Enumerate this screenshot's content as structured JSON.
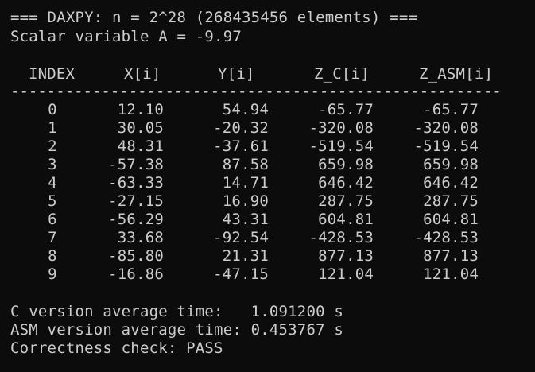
{
  "terminal": {
    "header_line": "=== DAXPY: n = 2^28 (268435456 elements) ===",
    "scalar_line": "Scalar variable A = -9.97",
    "columns": [
      "INDEX",
      "X[i]",
      "Y[i]",
      "Z_C[i]",
      "Z_ASM[i]"
    ],
    "rule": "------------------------------------------------------",
    "rows": [
      {
        "index": "0",
        "x": "12.10",
        "y": "54.94",
        "zc": "-65.77",
        "zasm": "-65.77"
      },
      {
        "index": "1",
        "x": "30.05",
        "y": "-20.32",
        "zc": "-320.08",
        "zasm": "-320.08"
      },
      {
        "index": "2",
        "x": "48.31",
        "y": "-37.61",
        "zc": "-519.54",
        "zasm": "-519.54"
      },
      {
        "index": "3",
        "x": "-57.38",
        "y": "87.58",
        "zc": "659.98",
        "zasm": "659.98"
      },
      {
        "index": "4",
        "x": "-63.33",
        "y": "14.71",
        "zc": "646.42",
        "zasm": "646.42"
      },
      {
        "index": "5",
        "x": "-27.15",
        "y": "16.90",
        "zc": "287.75",
        "zasm": "287.75"
      },
      {
        "index": "6",
        "x": "-56.29",
        "y": "43.31",
        "zc": "604.81",
        "zasm": "604.81"
      },
      {
        "index": "7",
        "x": "33.68",
        "y": "-92.54",
        "zc": "-428.53",
        "zasm": "-428.53"
      },
      {
        "index": "8",
        "x": "-85.80",
        "y": "21.31",
        "zc": "877.13",
        "zasm": "877.13"
      },
      {
        "index": "9",
        "x": "-16.86",
        "y": "-47.15",
        "zc": "121.04",
        "zasm": "121.04"
      }
    ],
    "c_time_line": "C version average time:   1.091200 s",
    "asm_time_line": "ASM version average time: 0.453767 s",
    "check_line": "Correctness check: PASS"
  },
  "colors": {
    "background": "#0c0c0c",
    "text": "#cccccc"
  }
}
